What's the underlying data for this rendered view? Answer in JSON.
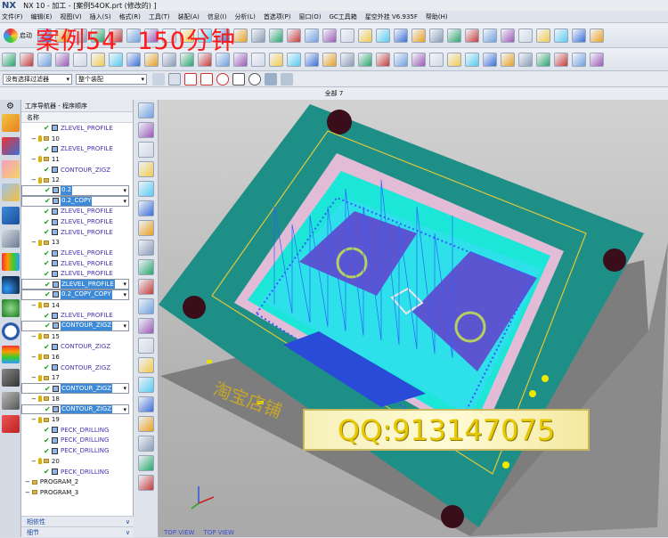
{
  "titlebar": {
    "logo": "NX",
    "title": "NX 10 - 加工 - [案例54OK.prt  (修改的) ]"
  },
  "menu": [
    "文件(F)",
    "编辑(E)",
    "视图(V)",
    "插入(S)",
    "格式(R)",
    "工具(T)",
    "装配(A)",
    "信息(I)",
    "分析(L)",
    "首选项(P)",
    "窗口(O)",
    "GC工具箱",
    "星空外挂 V6.935F",
    "帮助(H)"
  ],
  "toolbar": {
    "start_label": "启动"
  },
  "overlay": {
    "line1": "案例54",
    "line2": "150分钟"
  },
  "filter": {
    "selection_filter": "没有选择过滤器",
    "assembly_scope": "整个装配"
  },
  "section_title": "全部 7",
  "navigator": {
    "title": "工序导航器 - 程序顺序",
    "column_name": "名称",
    "rows": [
      {
        "type": "op",
        "label": "ZLEVEL_PROFILE",
        "indent": 3,
        "selected": false
      },
      {
        "type": "group",
        "label": "10",
        "indent": 1
      },
      {
        "type": "op",
        "label": "ZLEVEL_PROFILE",
        "indent": 3,
        "selected": false
      },
      {
        "type": "group",
        "label": "11",
        "indent": 1
      },
      {
        "type": "op",
        "label": "CONTOUR_ZIGZ",
        "indent": 3,
        "selected": false
      },
      {
        "type": "group",
        "label": "12",
        "indent": 1
      },
      {
        "type": "op",
        "label": "0.2",
        "indent": 3,
        "selected": true
      },
      {
        "type": "op",
        "label": "0.2_COPY",
        "indent": 3,
        "selected": true
      },
      {
        "type": "op",
        "label": "ZLEVEL_PROFILE",
        "indent": 3,
        "selected": false
      },
      {
        "type": "op",
        "label": "ZLEVEL_PROFILE",
        "indent": 3,
        "selected": false
      },
      {
        "type": "op",
        "label": "ZLEVEL_PROFILE",
        "indent": 3,
        "selected": false
      },
      {
        "type": "group",
        "label": "13",
        "indent": 1
      },
      {
        "type": "op",
        "label": "ZLEVEL_PROFILE",
        "indent": 3,
        "selected": false
      },
      {
        "type": "op",
        "label": "ZLEVEL_PROFILE",
        "indent": 3,
        "selected": false
      },
      {
        "type": "op",
        "label": "ZLEVEL_PROFILE",
        "indent": 3,
        "selected": false
      },
      {
        "type": "op",
        "label": "ZLEVEL_PROFILE",
        "indent": 3,
        "selected": true
      },
      {
        "type": "op",
        "label": "0.2_COPY_COPY",
        "indent": 3,
        "selected": true
      },
      {
        "type": "group",
        "label": "14",
        "indent": 1
      },
      {
        "type": "op",
        "label": "ZLEVEL_PROFILE",
        "indent": 3,
        "selected": false
      },
      {
        "type": "op",
        "label": "CONTOUR_ZIGZ",
        "indent": 3,
        "selected": true
      },
      {
        "type": "group",
        "label": "15",
        "indent": 1
      },
      {
        "type": "op",
        "label": "CONTOUR_ZIGZ",
        "indent": 3,
        "selected": false
      },
      {
        "type": "group",
        "label": "16",
        "indent": 1
      },
      {
        "type": "op",
        "label": "CONTOUR_ZIGZ",
        "indent": 3,
        "selected": false
      },
      {
        "type": "group",
        "label": "17",
        "indent": 1
      },
      {
        "type": "op",
        "label": "CONTOUR_ZIGZ",
        "indent": 3,
        "selected": true
      },
      {
        "type": "group",
        "label": "18",
        "indent": 1
      },
      {
        "type": "op",
        "label": "CONTOUR_ZIGZ",
        "indent": 3,
        "selected": true
      },
      {
        "type": "group",
        "label": "19",
        "indent": 1
      },
      {
        "type": "op",
        "label": "PECK_DRILLING",
        "indent": 3,
        "selected": false
      },
      {
        "type": "op",
        "label": "PECK_DRILLING",
        "indent": 3,
        "selected": false
      },
      {
        "type": "op",
        "label": "PECK_DRILLING",
        "indent": 3,
        "selected": false
      },
      {
        "type": "group",
        "label": "20",
        "indent": 1
      },
      {
        "type": "op",
        "label": "PECK_DRILLING",
        "indent": 3,
        "selected": false
      },
      {
        "type": "prog",
        "label": "PROGRAM_2",
        "indent": 0
      },
      {
        "type": "prog",
        "label": "PROGRAM_3",
        "indent": 0
      }
    ],
    "footer": [
      "相依性",
      "细节"
    ]
  },
  "viewport": {
    "view_labels": [
      "TOP VIEW",
      "TOP VIEW"
    ],
    "watermark_visible_text": "淘宝店铺"
  },
  "qq_banner": "QQ:913147075",
  "colors": {
    "selection": "#3d8ad9",
    "op_text": "#4b2fb0",
    "overlay_red": "#ff1a1a",
    "qq_yellow": "#e8c800"
  }
}
